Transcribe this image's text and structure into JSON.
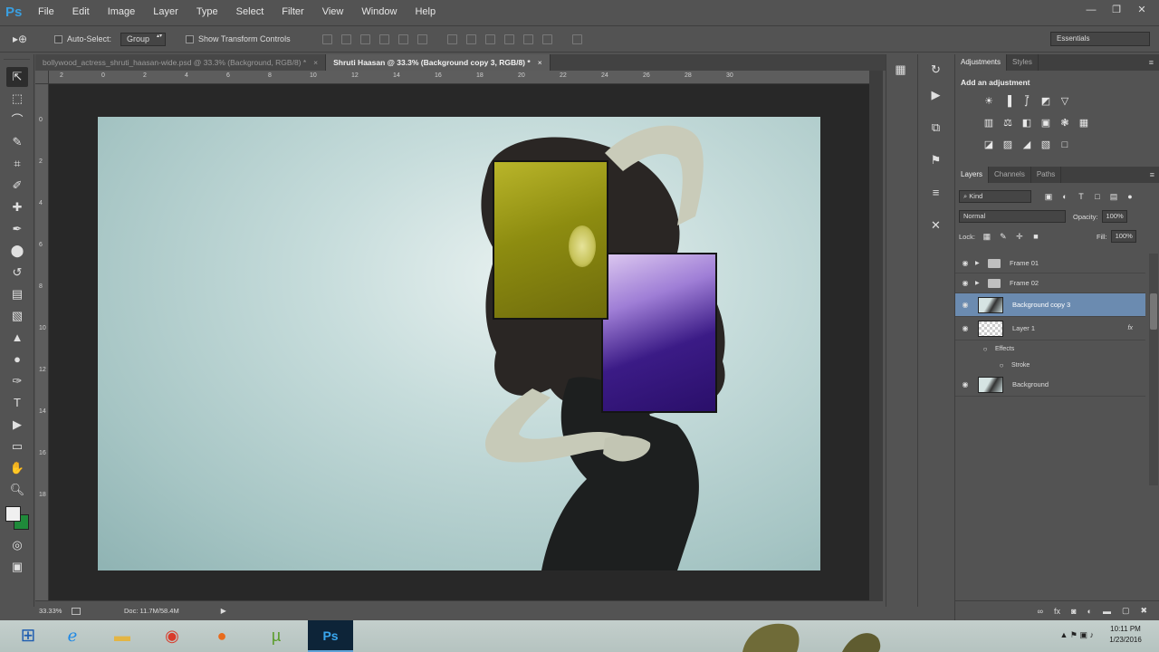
{
  "app": {
    "logo": "Ps",
    "menu": [
      "File",
      "Edit",
      "Image",
      "Layer",
      "Type",
      "Select",
      "Filter",
      "View",
      "Window",
      "Help"
    ],
    "window_controls": [
      "—",
      "❐",
      "✕"
    ]
  },
  "options": {
    "tool_glyph": "▸⊕",
    "auto_select_label": "Auto-Select:",
    "auto_select_value": "Group",
    "show_transform_label": "Show Transform Controls",
    "workspace": "Essentials"
  },
  "tabs": [
    {
      "label": "bollywood_actress_shruti_haasan-wide.psd @ 33.3% (Background, RGB/8) *",
      "close": "×",
      "active": false
    },
    {
      "label": "Shruti Haasan @ 33.3% (Background copy 3, RGB/8) *",
      "close": "×",
      "active": true
    }
  ],
  "rulers": {
    "h": [
      "2",
      "0",
      "2",
      "4",
      "6",
      "8",
      "10",
      "12",
      "14",
      "16",
      "18",
      "20",
      "22",
      "24",
      "26",
      "28",
      "30"
    ],
    "v": [
      "0",
      "2",
      "4",
      "6",
      "8",
      "10",
      "12",
      "14",
      "16",
      "18"
    ]
  },
  "status": {
    "zoom": "33.33%",
    "doc": "Doc: 11.7M/58.4M",
    "arrow": "▶"
  },
  "panels": {
    "adjustments_tab": "Adjustments",
    "styles_tab": "Styles",
    "menu_glyph": "≡",
    "add_adjustment": "Add an adjustment",
    "layers_tab": "Layers",
    "channels_tab": "Channels",
    "paths_tab": "Paths",
    "filter_kind": "⌕ Kind",
    "blend_mode": "Normal",
    "opacity_label": "Opacity:",
    "opacity_value": "100%",
    "lock_label": "Lock:",
    "fill_label": "Fill:",
    "fill_value": "100%",
    "layers": [
      {
        "name": "Frame 01",
        "type": "group"
      },
      {
        "name": "Frame 02",
        "type": "group"
      },
      {
        "name": "Background copy 3",
        "type": "pixel",
        "selected": true
      },
      {
        "name": "Layer 1",
        "type": "pixel-empty",
        "fx": "fx"
      },
      {
        "name": "Effects",
        "type": "sub"
      },
      {
        "name": "Stroke",
        "type": "sub2"
      },
      {
        "name": "Background",
        "type": "pixel"
      }
    ]
  },
  "taskbar": {
    "start_glyph": "⊞",
    "ps_label": "Ps",
    "tray_glyphs": "▲  ⚑  ▣  ♪",
    "time": "10:11 PM",
    "date": "1/23/2016"
  }
}
